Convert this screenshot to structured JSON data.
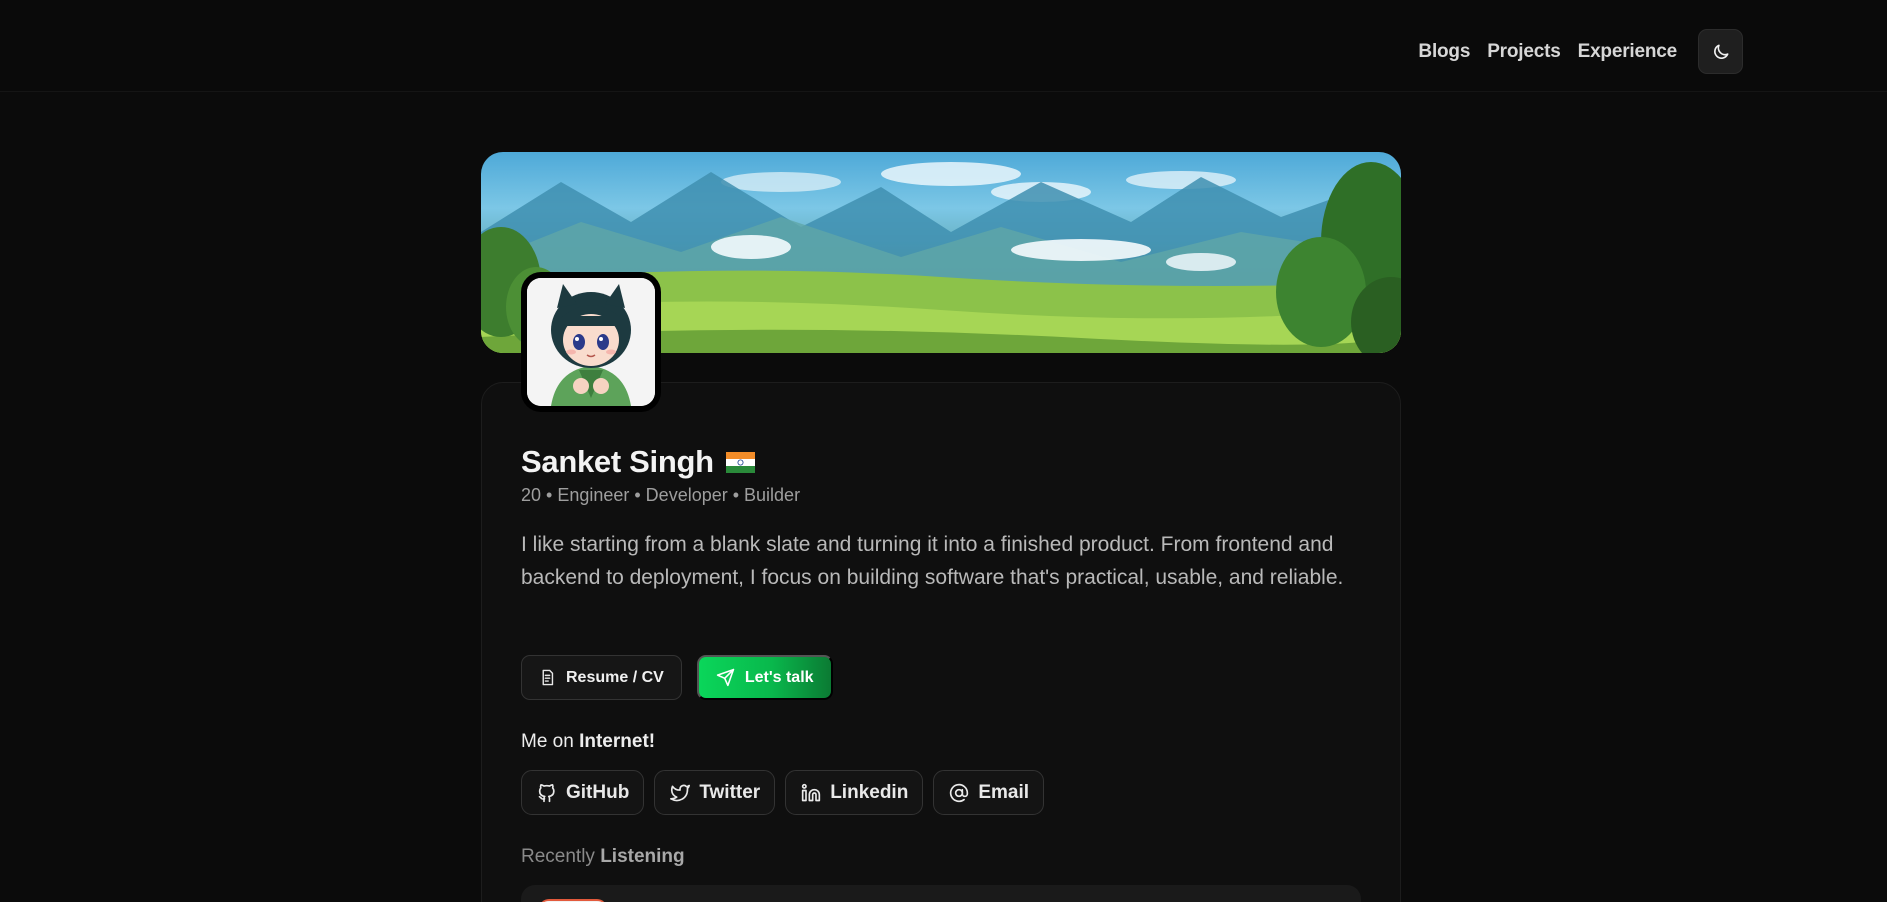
{
  "nav": {
    "links": [
      "Blogs",
      "Projects",
      "Experience"
    ],
    "theme_icon": "moon-icon"
  },
  "profile": {
    "name": "Sanket Singh",
    "flag_icon": "india-flag-icon",
    "tagline": "20 • Engineer • Developer • Builder",
    "bio": "I like starting from a blank slate and turning it into a finished product. From frontend and backend to deployment, I focus on building software that's practical, usable, and reliable."
  },
  "actions": {
    "resume_label": "Resume / CV",
    "talk_label": "Let's talk"
  },
  "internet": {
    "label_prefix": "Me on ",
    "label_bold": "Internet!",
    "links": [
      "GitHub",
      "Twitter",
      "Linkedin",
      "Email"
    ]
  },
  "listening": {
    "label_prefix": "Recently ",
    "label_bold": "Listening"
  },
  "colors": {
    "background": "#0b0b0b",
    "accent_green": "#0ad65a",
    "card": "#0f0f0f"
  }
}
